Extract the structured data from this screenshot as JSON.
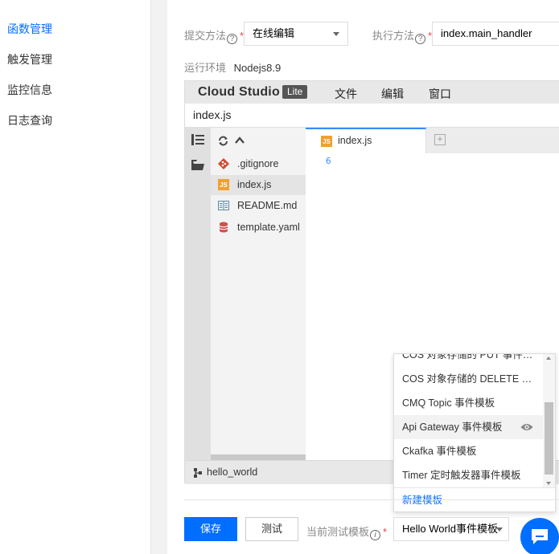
{
  "sidebar": {
    "items": [
      {
        "label": "函数管理",
        "active": true
      },
      {
        "label": "触发管理",
        "active": false
      },
      {
        "label": "监控信息",
        "active": false
      },
      {
        "label": "日志查询",
        "active": false
      }
    ]
  },
  "form": {
    "submit_method_label": "提交方法",
    "submit_method_value": "在线编辑",
    "exec_method_label": "执行方法",
    "exec_method_value": "index.main_handler",
    "runtime_label": "运行环境",
    "runtime_value": "Nodejs8.9"
  },
  "ide": {
    "brand": "Cloud Studio",
    "brand_badge": "Lite",
    "menus": [
      "文件",
      "编辑",
      "窗口"
    ],
    "current_file": "index.js",
    "files": [
      {
        "name": ".gitignore",
        "icon": "git-icon"
      },
      {
        "name": "index.js",
        "icon": "js-file-icon",
        "selected": true
      },
      {
        "name": "README.md",
        "icon": "markdown-icon"
      },
      {
        "name": "template.yaml",
        "icon": "database-icon"
      }
    ],
    "open_tab": "index.js",
    "line_number": "6",
    "status_project": "hello_world"
  },
  "dropdown": {
    "items": [
      "COS 对象存储的 PUT 事件…",
      "COS 对象存储的 DELETE …",
      "CMQ Topic 事件模板",
      "Api Gateway 事件模板",
      "Ckafka 事件模板",
      "Timer 定时触发器事件模板"
    ],
    "hover_index": 3,
    "new_template": "新建模板"
  },
  "bottom": {
    "save_label": "保存",
    "test_label": "测试",
    "template_label": "当前测试模板",
    "template_value": "Hello World事件模板"
  },
  "colors": {
    "accent": "#006eff",
    "required": "#e54545"
  }
}
